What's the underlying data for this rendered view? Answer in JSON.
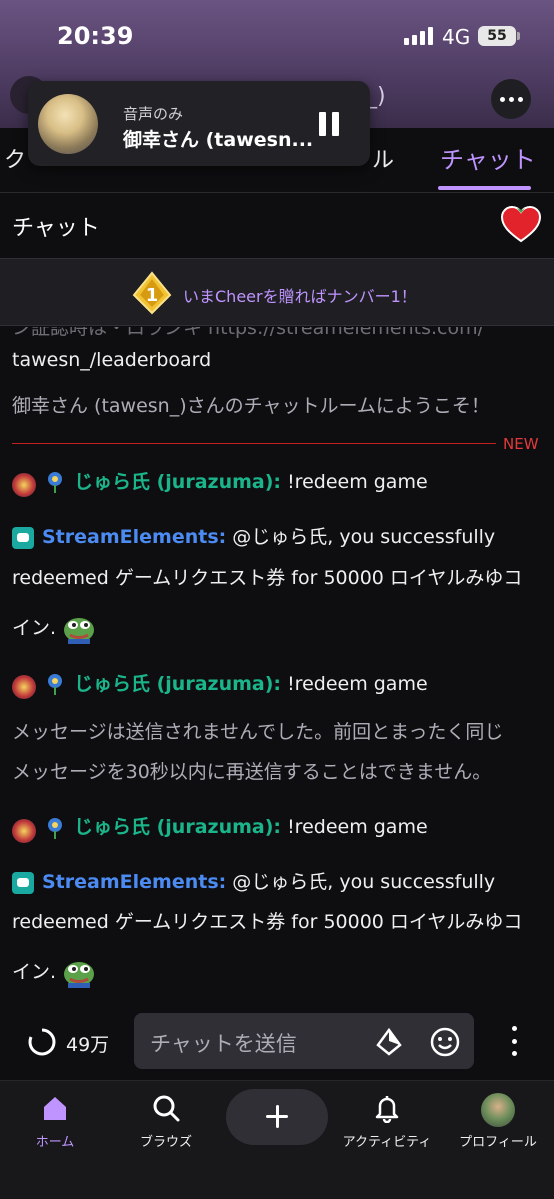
{
  "status": {
    "time": "20:39",
    "network": "4G",
    "battery": "55"
  },
  "header": {
    "title_tail": "_)"
  },
  "player": {
    "subtitle": "音声のみ",
    "title": "御幸さん (tawesn..."
  },
  "tabs": {
    "left_partial": "ク",
    "mid_partial": "ル",
    "chat": "チャット"
  },
  "chat_header": {
    "title": "チャット"
  },
  "cheer_banner": {
    "text": "いまCheerを贈ればナンバー1！"
  },
  "messages": {
    "partial_top": "ン証認時は・ロランキ https://streamelements.com/",
    "line_leaderboard": "tawesn_/leaderboard",
    "welcome": "御幸さん (tawesn_)さんのチャットルームにようこそ！",
    "new_label": "NEW",
    "m1_user": "じゅら氏 (jurazuma):",
    "m1_text": "!redeem game",
    "m2_user": "StreamElements:",
    "m2_text1": "@じゅら氏, you successfully",
    "m2_text2": "redeemed ゲームリクエスト券 for 50000 ロイヤルみゆコ",
    "m2_text3": "イン.",
    "m3_user": "じゅら氏 (jurazuma):",
    "m3_text": "!redeem game",
    "sys1": "メッセージは送信されませんでした。前回とまったく同じ",
    "sys2": "メッセージを30秒以内に再送信することはできません。",
    "m4_user": "じゅら氏 (jurazuma):",
    "m4_text": "!redeem game",
    "m5_user": "StreamElements:",
    "m5_text1": "@じゅら氏, you successfully",
    "m5_text2": "redeemed ゲームリクエスト券 for 50000 ロイヤルみゆコ",
    "m5_text3": "イン."
  },
  "input": {
    "points": "49万",
    "placeholder": "チャットを送信"
  },
  "nav": {
    "home": "ホーム",
    "browse": "ブラウズ",
    "activity": "アクティビティ",
    "profile": "プロフィール"
  },
  "colors": {
    "accent": "#bf94ff",
    "green_user": "#1bb58b",
    "blue_user": "#4b8bf2",
    "new_red": "#e03a3a"
  }
}
